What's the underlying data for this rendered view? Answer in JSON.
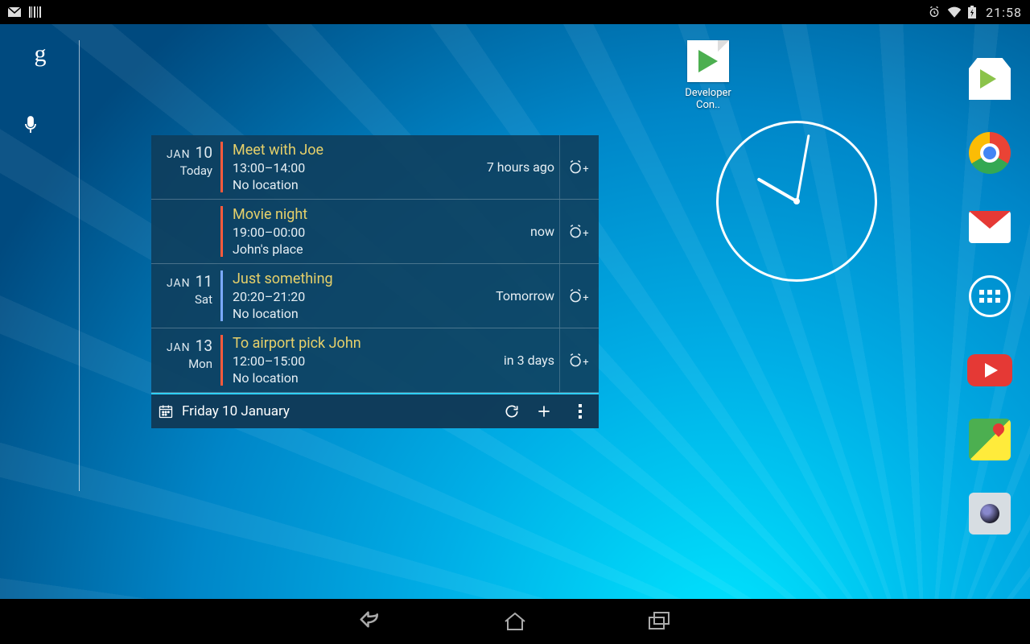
{
  "statusbar": {
    "time": "21:58",
    "icons": [
      "gmail-notif-icon",
      "barcode-icon",
      "alarm-icon",
      "wifi-icon",
      "battery-charging-icon"
    ]
  },
  "google": {
    "letter": "g"
  },
  "shortcut": {
    "label": "Developer Con.."
  },
  "calendar": {
    "events": [
      {
        "month": "JAN",
        "day": "10",
        "sub": "Today",
        "stripe": "red",
        "title": "Meet with Joe",
        "time": "13:00–14:00",
        "loc": "No location",
        "rel": "7 hours ago"
      },
      {
        "month": "",
        "day": "",
        "sub": "",
        "stripe": "red",
        "title": "Movie night",
        "time": "19:00–00:00",
        "loc": "John's place",
        "rel": "now"
      },
      {
        "month": "JAN",
        "day": "11",
        "sub": "Sat",
        "stripe": "blue",
        "title": "Just something",
        "time": "20:20–21:20",
        "loc": "No location",
        "rel": "Tomorrow"
      },
      {
        "month": "JAN",
        "day": "13",
        "sub": "Mon",
        "stripe": "red",
        "title": "To airport pick John",
        "time": "12:00–15:00",
        "loc": "No location",
        "rel": "in 3 days"
      }
    ],
    "footer": {
      "label": "Friday 10 January"
    }
  },
  "dock": {
    "apps": [
      "play-store",
      "chrome",
      "gmail",
      "all-apps",
      "youtube",
      "maps",
      "camera"
    ]
  },
  "navbar": {
    "buttons": [
      "back",
      "home",
      "recent"
    ]
  }
}
